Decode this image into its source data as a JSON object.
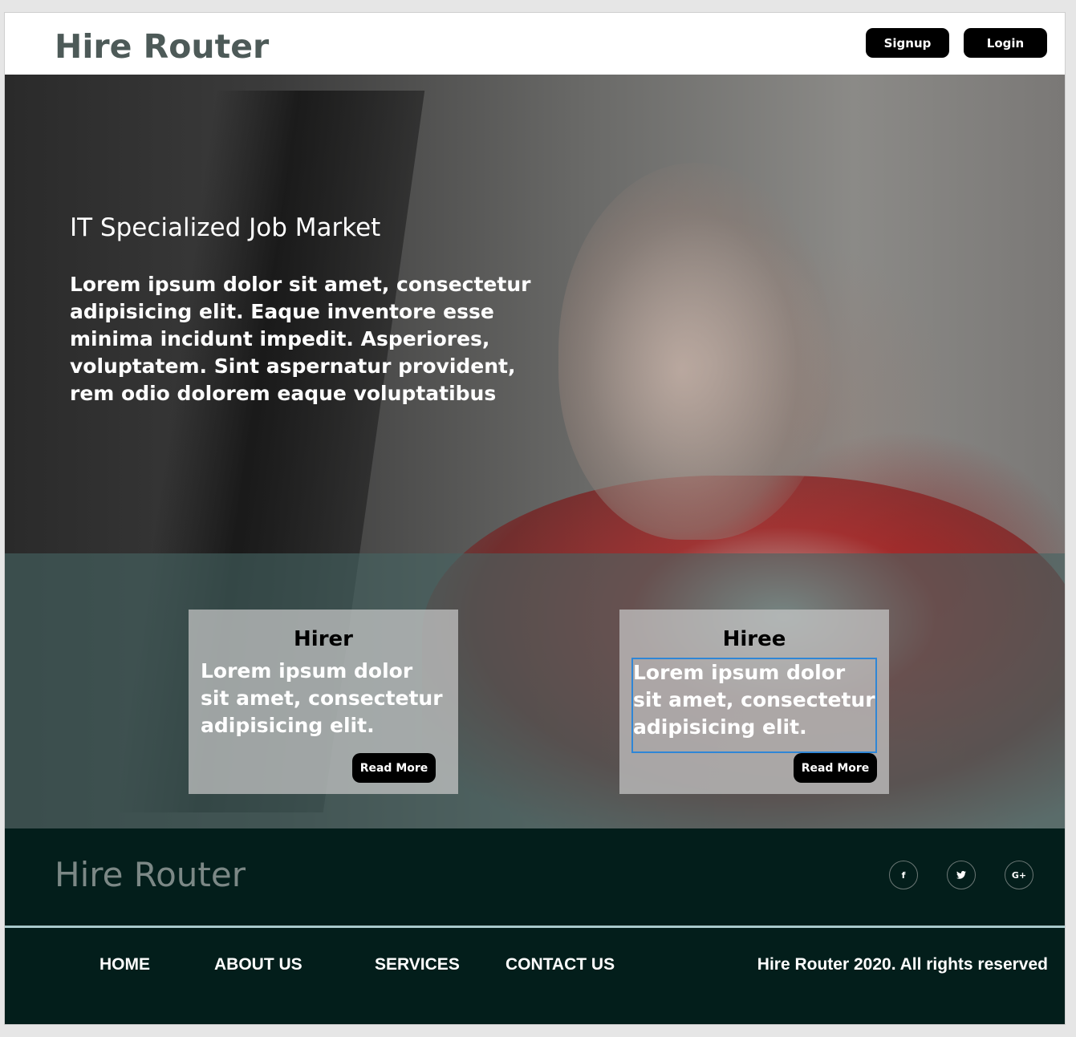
{
  "header": {
    "brand": "Hire Router",
    "signup_label": "Signup",
    "login_label": "Login"
  },
  "hero": {
    "title": "IT Specialized Job Market",
    "text": "Lorem ipsum dolor sit amet, consectetur adipisicing elit. Eaque inventore esse minima incidunt impedit. Asperiores, voluptatem. Sint aspernatur provident, rem odio dolorem eaque voluptatibus"
  },
  "cards": [
    {
      "title": "Hirer",
      "text": "Lorem ipsum dolor sit amet, consectetur adipisicing elit.",
      "button_label": "Read More"
    },
    {
      "title": "Hiree",
      "text": "Lorem ipsum dolor sit amet, consectetur adipisicing elit.",
      "button_label": "Read More"
    }
  ],
  "footer": {
    "brand": "Hire Router",
    "social": [
      {
        "icon": "facebook-icon",
        "glyph": "f"
      },
      {
        "icon": "twitter-icon",
        "glyph": "t"
      },
      {
        "icon": "google-plus-icon",
        "glyph": "G+"
      }
    ],
    "nav": [
      "HOME",
      "ABOUT US",
      "SERVICES",
      "CONTACT US"
    ],
    "copyright": "Hire Router 2020. All rights reserved"
  },
  "colors": {
    "button_bg": "#000000",
    "brand_text": "#4d5a58",
    "footer_bg": "#031e1b",
    "footer_divider": "#a9c9cc",
    "selection_outline": "#2f86d6"
  }
}
